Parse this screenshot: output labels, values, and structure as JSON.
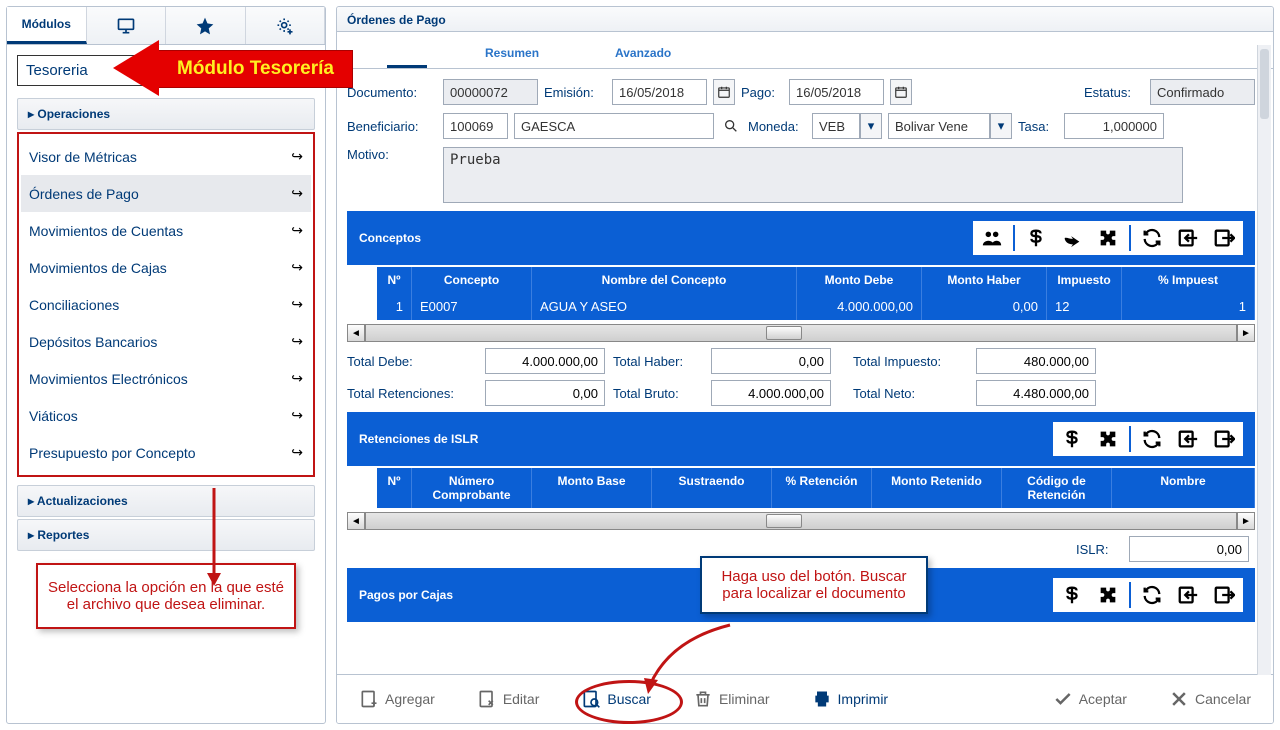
{
  "left": {
    "tabs": {
      "modules": "Módulos"
    },
    "module_name": "Tesoreria",
    "acc": {
      "operaciones": "Operaciones",
      "actualizaciones": "Actualizaciones",
      "reportes": "Reportes"
    },
    "nav": [
      "Visor de Métricas",
      "Órdenes de Pago",
      "Movimientos de Cuentas",
      "Movimientos de Cajas",
      "Conciliaciones",
      "Depósitos Bancarios",
      "Movimientos Electrónicos",
      "Viáticos",
      "Presupuesto por Concepto"
    ],
    "callout": "Selecciona la opción en la que esté el archivo que desea eliminar."
  },
  "right": {
    "title": "Órdenes de Pago",
    "tabs": {
      "main_hidden": "",
      "resumen": "Resumen",
      "avanzado": "Avanzado"
    },
    "form": {
      "documento_lbl": "Documento:",
      "documento": "00000072",
      "emision_lbl": "Emisión:",
      "emision": "16/05/2018",
      "pago_lbl": "Pago:",
      "pago": "16/05/2018",
      "estatus_lbl": "Estatus:",
      "estatus": "Confirmado",
      "beneficiario_lbl": "Beneficiario:",
      "benef_code": "100069",
      "benef_name": "GAESCA",
      "moneda_lbl": "Moneda:",
      "moneda_code": "VEB",
      "moneda_name": "Bolivar Vene",
      "tasa_lbl": "Tasa:",
      "tasa": "1,000000",
      "motivo_lbl": "Motivo:",
      "motivo": "Prueba"
    },
    "conceptos": {
      "title": "Conceptos",
      "cols": {
        "no": "Nº",
        "concepto": "Concepto",
        "nombre": "Nombre del Concepto",
        "debe": "Monto Debe",
        "haber": "Monto Haber",
        "impuesto": "Impuesto",
        "pct": "% Impuest"
      },
      "row": {
        "no": "1",
        "concepto": "E0007",
        "nombre": "AGUA Y ASEO",
        "debe": "4.000.000,00",
        "haber": "0,00",
        "impuesto": "12",
        "pct": "1"
      },
      "totals": {
        "debe_lbl": "Total Debe:",
        "debe": "4.000.000,00",
        "haber_lbl": "Total Haber:",
        "haber": "0,00",
        "impuesto_lbl": "Total Impuesto:",
        "impuesto": "480.000,00",
        "ret_lbl": "Total Retenciones:",
        "ret": "0,00",
        "bruto_lbl": "Total Bruto:",
        "bruto": "4.000.000,00",
        "neto_lbl": "Total Neto:",
        "neto": "4.480.000,00"
      }
    },
    "islr": {
      "title": "Retenciones de ISLR",
      "cols": {
        "no": "Nº",
        "comprobante": "Número Comprobante",
        "base": "Monto Base",
        "sustraendo": "Sustraendo",
        "pct": "% Retención",
        "retenido": "Monto Retenido",
        "codigo": "Código de Retención",
        "nombre": "Nombre"
      },
      "total_lbl": "ISLR:",
      "total": "0,00"
    },
    "pagos_cajas": {
      "title": "Pagos por Cajas"
    },
    "buttons": {
      "agregar": "Agregar",
      "editar": "Editar",
      "buscar": "Buscar",
      "eliminar": "Eliminar",
      "imprimir": "Imprimir",
      "aceptar": "Aceptar",
      "cancelar": "Cancelar"
    }
  },
  "annotations": {
    "module_arrow": "Módulo Tesorería",
    "search_tip": "Haga uso del botón. Buscar para localizar el documento"
  }
}
